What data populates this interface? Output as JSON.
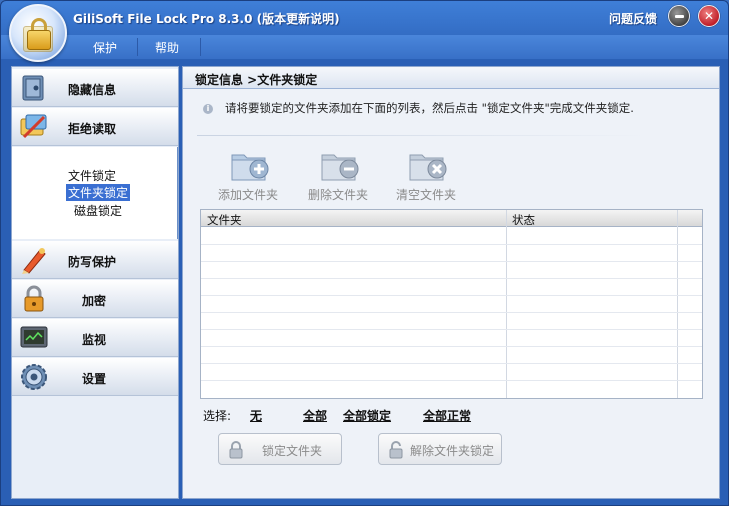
{
  "window": {
    "title": "GiliSoft File Lock Pro 8.3.0 (版本更新说明)",
    "feedback_label": "问题反馈"
  },
  "menu": {
    "items": [
      {
        "label": "保护"
      },
      {
        "label": "帮助"
      }
    ]
  },
  "sidebar": {
    "items": [
      {
        "label": "隐藏信息",
        "icon": "hidden-safe-icon"
      },
      {
        "label": "拒绝读取",
        "icon": "deny-read-icon"
      },
      {
        "label": "防写保护",
        "icon": "write-protect-pen-icon"
      },
      {
        "label": "加密",
        "icon": "encrypt-lock-icon"
      },
      {
        "label": "监视",
        "icon": "monitor-icon"
      },
      {
        "label": "设置",
        "icon": "settings-gear-icon"
      }
    ],
    "submenu": [
      {
        "label": "文件锁定",
        "selected": false
      },
      {
        "label": "文件夹锁定",
        "selected": true
      },
      {
        "label": "磁盘锁定",
        "selected": false
      }
    ]
  },
  "main": {
    "breadcrumb": "锁定信息 >文件夹锁定",
    "info_text": "请将要锁定的文件夹添加在下面的列表，然后点击 \"锁定文件夹\"完成文件夹锁定.",
    "toolbar": {
      "add_label": "添加文件夹",
      "delete_label": "删除文件夹",
      "clear_label": "清空文件夹"
    },
    "table": {
      "columns": [
        "文件夹",
        "状态"
      ],
      "rows": []
    },
    "selection": {
      "label": "选择:",
      "none": "无",
      "all": "全部",
      "all_locked": "全部锁定",
      "all_normal": "全部正常"
    },
    "buttons": {
      "lock_folder": "锁定文件夹",
      "unlock_folder": "解除文件夹锁定"
    }
  }
}
